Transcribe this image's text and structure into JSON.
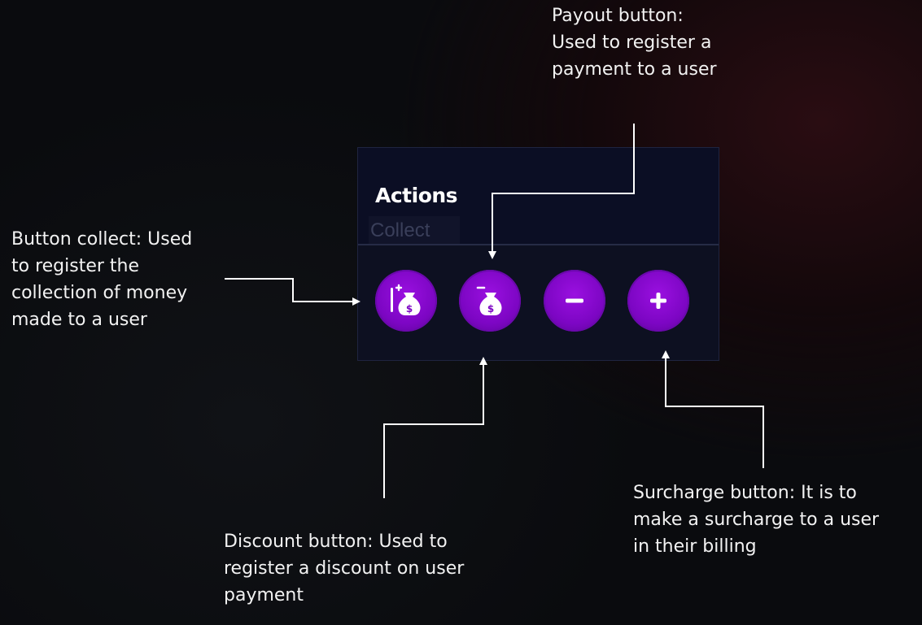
{
  "panel": {
    "title": "Actions",
    "ghost_tab": "Collect"
  },
  "buttons": [
    {
      "id": "collect",
      "icon": "money-bag-plus-icon"
    },
    {
      "id": "payout",
      "icon": "money-bag-minus-icon"
    },
    {
      "id": "discount",
      "icon": "minus-icon"
    },
    {
      "id": "surcharge",
      "icon": "plus-icon"
    }
  ],
  "annotations": {
    "payout": [
      "Payout button:",
      "Used to register a",
      "payment to a user"
    ],
    "collect": [
      "Button collect: Used",
      "to register the",
      "collection of money",
      "made to a user"
    ],
    "discount": [
      "Discount button: Used to",
      "register a discount on user",
      "payment"
    ],
    "surcharge": [
      "Surcharge button: It is to",
      "make a surcharge to a user",
      "in their billing"
    ]
  },
  "colors": {
    "button_purple": "#7d06c4",
    "panel_bg": "#0b0e24",
    "annotation_text": "#f2f2f2"
  }
}
